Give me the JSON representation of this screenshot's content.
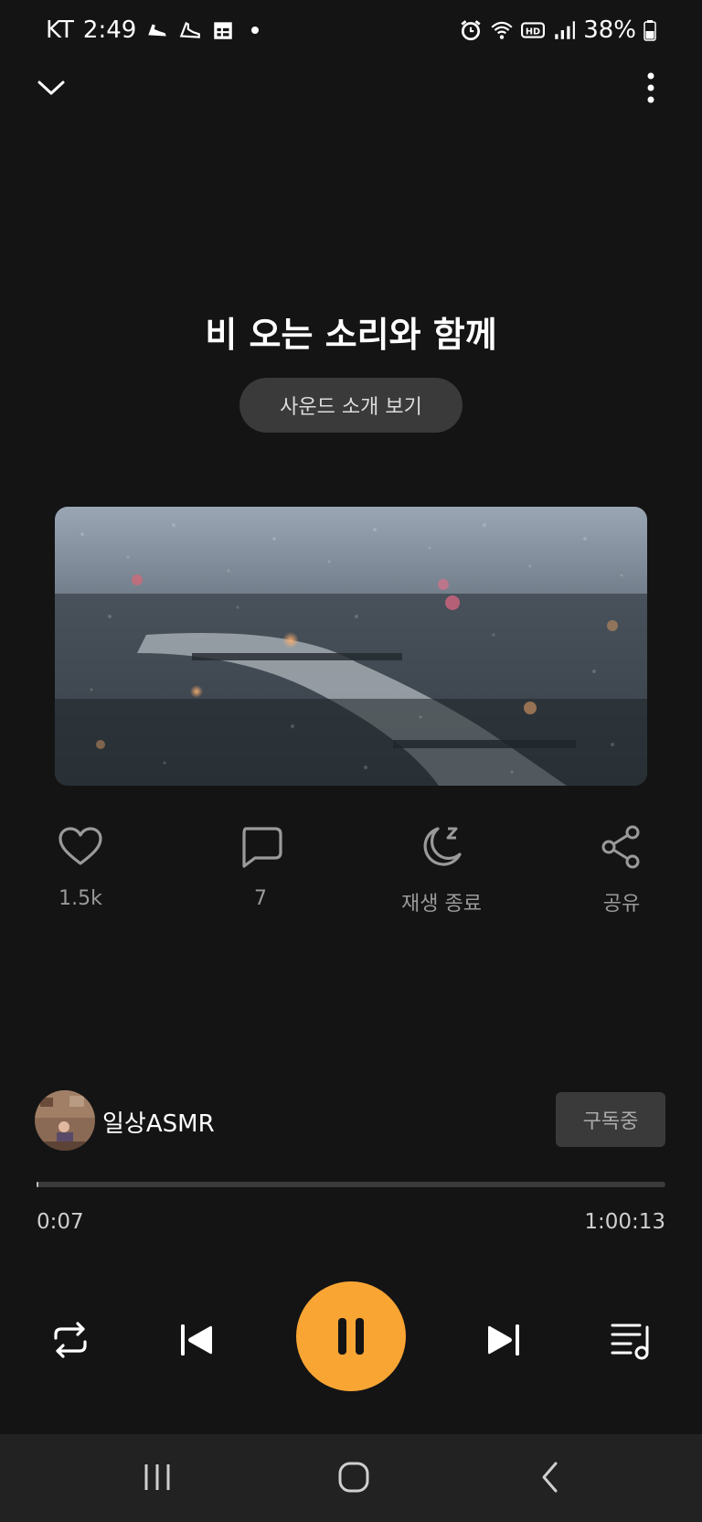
{
  "status_bar": {
    "carrier": "KT",
    "time": "2:49",
    "battery": "38%",
    "icons": [
      "sneaker-icon",
      "sneaker-icon",
      "calendar-icon",
      "alarm-icon",
      "wifi-icon",
      "hd-icon",
      "signal-icon",
      "battery-icon"
    ]
  },
  "top_bar": {
    "collapse_icon": "chevron-down-icon",
    "menu_icon": "more-vert-icon"
  },
  "track": {
    "title": "비 오는 소리와 함께",
    "intro_button": "사운드 소개 보기"
  },
  "actions": [
    {
      "icon": "heart-icon",
      "label": "1.5k"
    },
    {
      "icon": "comment-icon",
      "label": "7"
    },
    {
      "icon": "sleep-timer-icon",
      "label": "재생 종료"
    },
    {
      "icon": "share-icon",
      "label": "공유"
    }
  ],
  "channel": {
    "name": "일상ASMR",
    "subscribe_label": "구독중"
  },
  "progress": {
    "elapsed": "0:07",
    "duration": "1:00:13",
    "fraction": 0.002
  },
  "controls": {
    "repeat": "repeat-icon",
    "previous": "previous-icon",
    "pause": "pause-icon",
    "next": "next-icon",
    "playlist": "playlist-icon"
  },
  "colors": {
    "accent": "#f9a534",
    "background": "#141414"
  }
}
